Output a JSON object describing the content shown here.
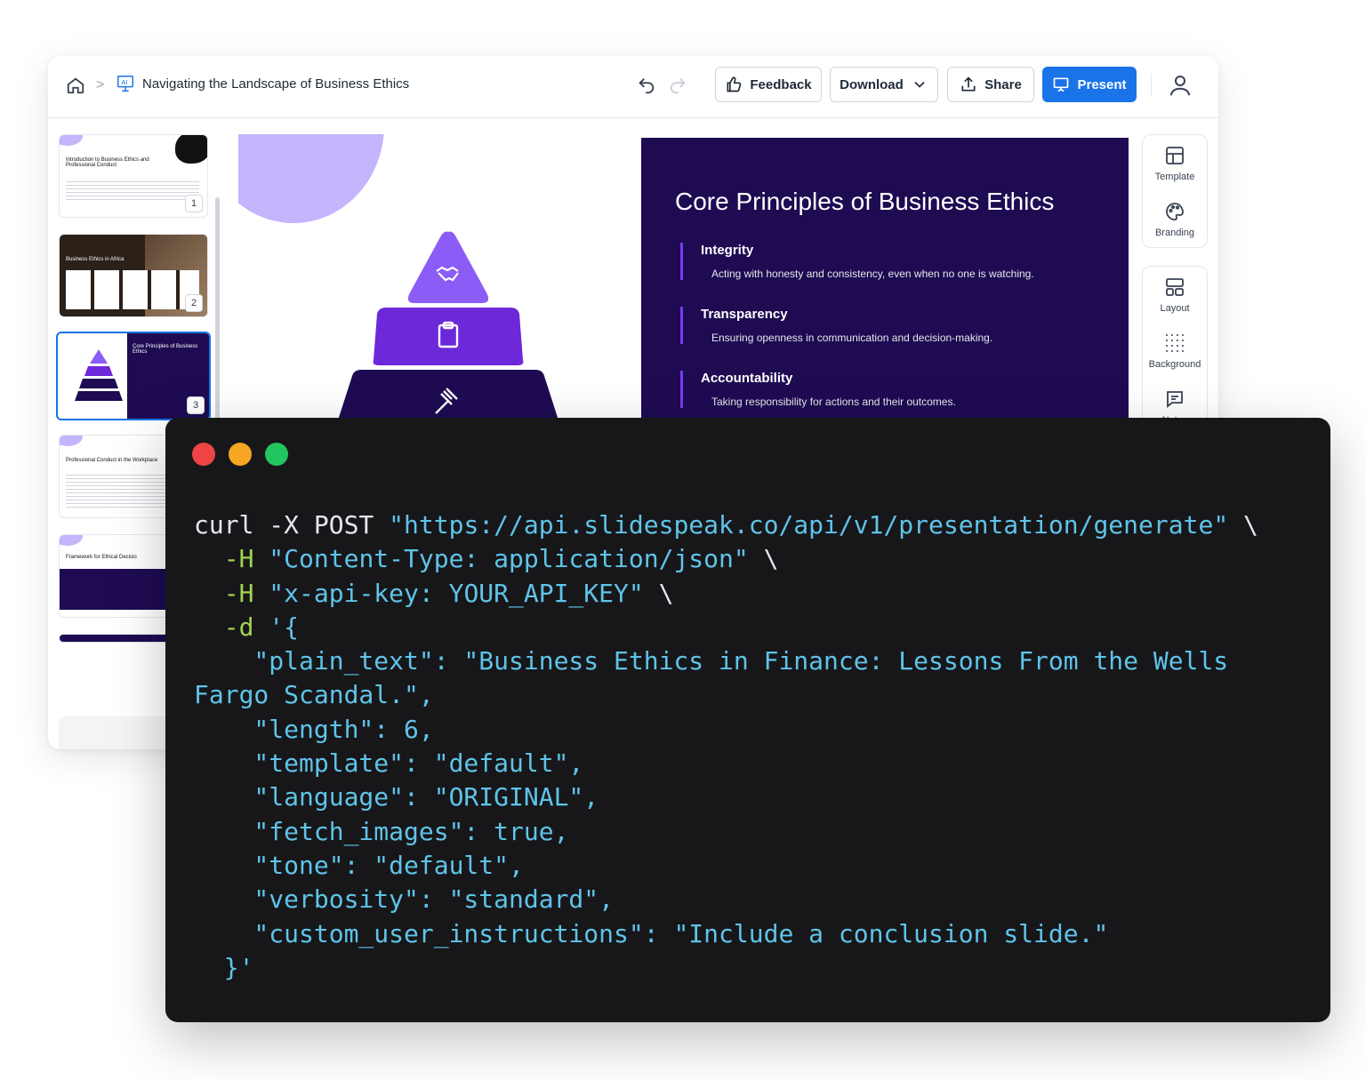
{
  "topbar": {
    "breadcrumb_sep": ">",
    "title": "Navigating the Landscape of Business Ethics",
    "feedback_label": "Feedback",
    "download_label": "Download",
    "share_label": "Share",
    "present_label": "Present"
  },
  "thumbnails": [
    {
      "title": "Introduction to Business Ethics and Professional Conduct",
      "number": "1"
    },
    {
      "title": "Business Ethics in Africa",
      "number": "2"
    },
    {
      "title": "Core Principles of Business Ethics",
      "number": "3"
    },
    {
      "title": "Professional Conduct in the Workplace",
      "number": ""
    },
    {
      "title": "Framework for Ethical Decisio",
      "number": ""
    }
  ],
  "add_slide_label": "+",
  "slide": {
    "heading": "Core Principles of Business Ethics",
    "principles": [
      {
        "name": "Integrity",
        "desc": "Acting with honesty and consistency, even when no one is watching."
      },
      {
        "name": "Transparency",
        "desc": "Ensuring openness in communication and decision-making."
      },
      {
        "name": "Accountability",
        "desc": "Taking responsibility for actions and their outcomes."
      }
    ],
    "colors": {
      "panel": "#1e0b52",
      "accent": "#7c3aed",
      "tier1": "#8b5cf6",
      "tier2": "#6d28d9",
      "tier3": "#1e0b52"
    }
  },
  "tools": {
    "template": "Template",
    "branding": "Branding",
    "layout": "Layout",
    "background": "Background",
    "notes": "Notes"
  },
  "terminal": {
    "lines": [
      [
        {
          "t": "curl -X ",
          "c": "plain"
        },
        {
          "t": "POST",
          "c": "plain"
        },
        {
          "t": " \"https://api.slidespeak.co/api/v1/presentation/generate\"",
          "c": "str"
        },
        {
          "t": " \\",
          "c": "plain"
        }
      ],
      [
        {
          "t": "  -H ",
          "c": "kw"
        },
        {
          "t": "\"Content-Type: application/json\"",
          "c": "str"
        },
        {
          "t": " \\",
          "c": "plain"
        }
      ],
      [
        {
          "t": "  -H ",
          "c": "kw"
        },
        {
          "t": "\"x-api-key: YOUR_API_KEY\"",
          "c": "str"
        },
        {
          "t": " \\",
          "c": "plain"
        }
      ],
      [
        {
          "t": "  -d ",
          "c": "kw"
        },
        {
          "t": "'{",
          "c": "str"
        }
      ],
      [
        {
          "t": "    \"plain_text\": \"Business Ethics in Finance: Lessons From the Wells",
          "c": "str"
        }
      ],
      [
        {
          "t": "Fargo Scandal.\",",
          "c": "str"
        }
      ],
      [
        {
          "t": "    \"length\": 6,",
          "c": "str"
        }
      ],
      [
        {
          "t": "    \"template\": \"default\",",
          "c": "str"
        }
      ],
      [
        {
          "t": "    \"language\": \"ORIGINAL\",",
          "c": "str"
        }
      ],
      [
        {
          "t": "    \"fetch_images\": true,",
          "c": "str"
        }
      ],
      [
        {
          "t": "    \"tone\": \"default\",",
          "c": "str"
        }
      ],
      [
        {
          "t": "    \"verbosity\": \"standard\",",
          "c": "str"
        }
      ],
      [
        {
          "t": "    \"custom_user_instructions\": \"Include a conclusion slide.\"",
          "c": "str"
        }
      ],
      [
        {
          "t": "  }'",
          "c": "str"
        }
      ]
    ],
    "colors": {
      "bg": "#17171a",
      "kw": "#a3d44f",
      "str": "#5fc4e8"
    }
  }
}
